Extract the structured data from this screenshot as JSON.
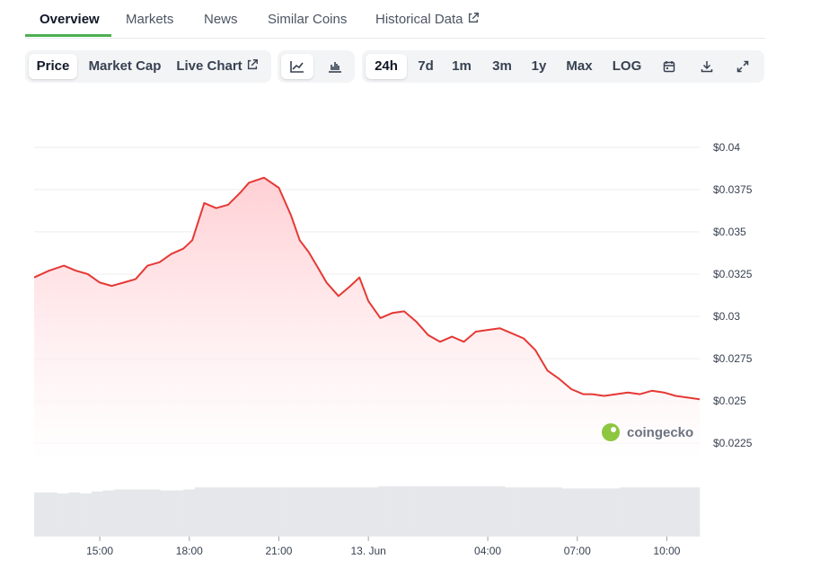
{
  "tabs": [
    {
      "label": "Overview"
    },
    {
      "label": "Markets"
    },
    {
      "label": "News"
    },
    {
      "label": "Similar Coins"
    },
    {
      "label": "Historical Data"
    }
  ],
  "toolbar": {
    "metrics": [
      "Price",
      "Market Cap",
      "Live Chart"
    ],
    "chart_types": [
      "line-chart-icon",
      "candlestick-chart-icon"
    ],
    "ranges": [
      "24h",
      "7d",
      "1m",
      "3m",
      "1y",
      "Max",
      "LOG"
    ],
    "tools": [
      "calendar-icon",
      "download-icon",
      "expand-icon"
    ],
    "active_metric": "Price",
    "active_range": "24h"
  },
  "watermark": "coingecko",
  "colors": {
    "line": "#e53935",
    "fill": "#ffcdd2",
    "grid": "#eeeeee",
    "volume": "#e5e7eb",
    "brand_green": "#4caf50"
  },
  "chart_data": {
    "type": "area",
    "ylim": [
      0.0215,
      0.041
    ],
    "yticks": [
      "$0.04",
      "$0.0375",
      "$0.035",
      "$0.0325",
      "$0.03",
      "$0.0275",
      "$0.025",
      "$0.0225"
    ],
    "ytick_values": [
      0.04,
      0.0375,
      0.035,
      0.0325,
      0.03,
      0.0275,
      0.025,
      0.0225
    ],
    "xlim": [
      12.8,
      35.1
    ],
    "xticks": [
      "15:00",
      "18:00",
      "21:00",
      "13. Jun",
      "04:00",
      "07:00",
      "10:00"
    ],
    "xtick_values": [
      15,
      18,
      21,
      24,
      28,
      31,
      34
    ],
    "x": [
      12.8,
      13.3,
      13.8,
      14.2,
      14.6,
      15.0,
      15.4,
      15.8,
      16.2,
      16.6,
      17.0,
      17.4,
      17.8,
      18.1,
      18.5,
      18.9,
      19.3,
      19.7,
      20.0,
      20.5,
      21.0,
      21.4,
      21.7,
      22.0,
      22.3,
      22.6,
      23.0,
      23.4,
      23.7,
      24.0,
      24.4,
      24.8,
      25.2,
      25.6,
      26.0,
      26.4,
      26.8,
      27.2,
      27.6,
      28.0,
      28.4,
      28.8,
      29.2,
      29.6,
      30.0,
      30.4,
      30.8,
      31.2,
      31.5,
      31.9,
      32.3,
      32.7,
      33.1,
      33.5,
      33.9,
      34.3,
      34.7,
      35.1
    ],
    "y": [
      0.0323,
      0.0327,
      0.033,
      0.0327,
      0.0325,
      0.032,
      0.0318,
      0.032,
      0.0322,
      0.033,
      0.0332,
      0.0337,
      0.034,
      0.0345,
      0.0367,
      0.0364,
      0.0366,
      0.0373,
      0.0379,
      0.0382,
      0.0376,
      0.036,
      0.0345,
      0.0338,
      0.0329,
      0.032,
      0.0312,
      0.0318,
      0.0323,
      0.0309,
      0.0299,
      0.0302,
      0.0303,
      0.0297,
      0.0289,
      0.0285,
      0.0288,
      0.0285,
      0.0291,
      0.0292,
      0.0293,
      0.029,
      0.0287,
      0.028,
      0.0268,
      0.0263,
      0.0257,
      0.0254,
      0.0254,
      0.0253,
      0.0254,
      0.0255,
      0.0254,
      0.0256,
      0.0255,
      0.0253,
      0.0252,
      0.0251
    ],
    "volume": [
      0.43,
      0.43,
      0.42,
      0.43,
      0.42,
      0.44,
      0.45,
      0.46,
      0.46,
      0.46,
      0.46,
      0.45,
      0.45,
      0.46,
      0.48,
      0.48,
      0.48,
      0.48,
      0.48,
      0.48,
      0.48,
      0.48,
      0.48,
      0.48,
      0.48,
      0.48,
      0.48,
      0.48,
      0.48,
      0.48,
      0.49,
      0.49,
      0.49,
      0.49,
      0.49,
      0.49,
      0.49,
      0.49,
      0.49,
      0.49,
      0.49,
      0.48,
      0.48,
      0.48,
      0.48,
      0.48,
      0.47,
      0.47,
      0.47,
      0.47,
      0.47,
      0.48,
      0.48,
      0.48,
      0.48,
      0.48,
      0.48,
      0.48
    ],
    "grid": true
  }
}
